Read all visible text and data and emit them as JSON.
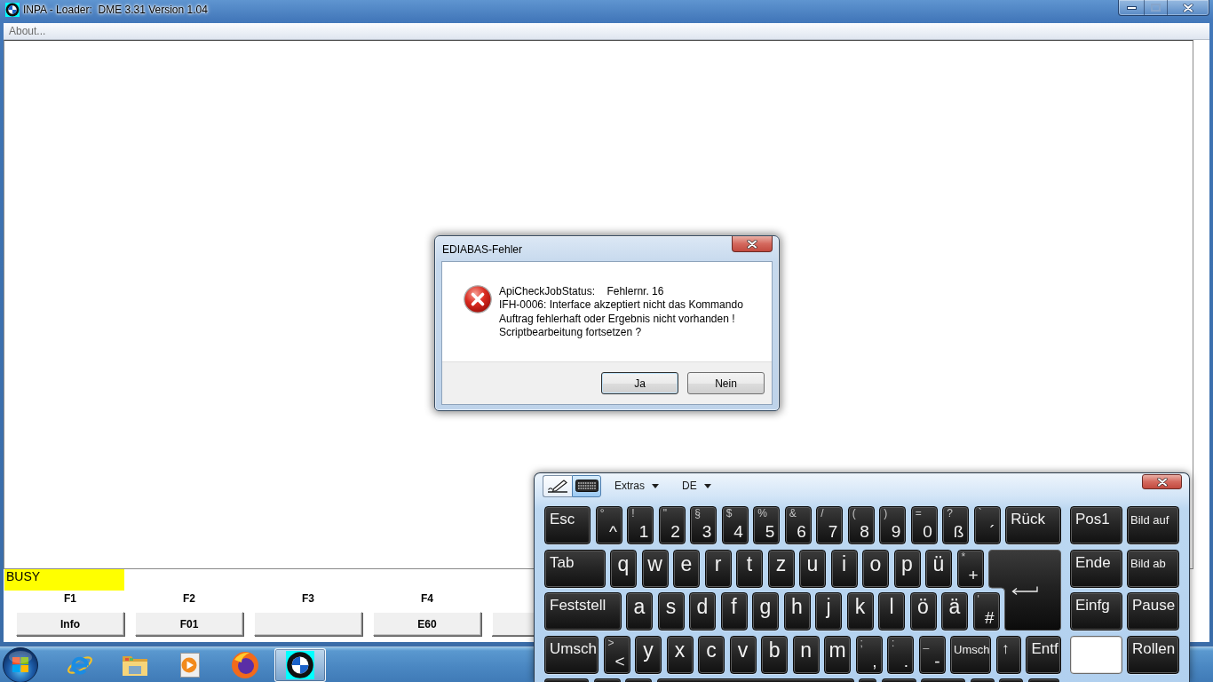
{
  "window": {
    "title": "INPA - Loader:  DME 3.31 Version 1.04",
    "caption_buttons": [
      {
        "kind": "minimize",
        "disabled": false
      },
      {
        "kind": "maximize",
        "disabled": true
      },
      {
        "kind": "close",
        "disabled": false
      }
    ]
  },
  "menu": [
    {
      "label": "About...",
      "disabled": true
    }
  ],
  "status": "BUSY",
  "function_keys": [
    {
      "key": "F1",
      "label": "Info",
      "partial": false
    },
    {
      "key": "F2",
      "label": "F01",
      "partial": false
    },
    {
      "key": "F3",
      "partial": false
    },
    {
      "key": "F4",
      "label": "E60",
      "partial": false
    },
    {
      "partial": true
    }
  ],
  "dialog": {
    "title": "EDIABAS-Fehler",
    "message": "ApiCheckJobStatus:    Fehlernr. 16\nIFH-0006: Interface akzeptiert nicht das Kommando\nAuftrag fehlerhaft oder Ergebnis nicht vorhanden !\nScriptbearbeitung fortsetzen ?",
    "buttons": [
      {
        "label": "Ja",
        "default": true
      },
      {
        "label": "Nein",
        "default": false
      }
    ]
  },
  "input_panel": {
    "modes": [
      {
        "kind": "pen",
        "selected": false
      },
      {
        "kind": "keyboard",
        "selected": true
      }
    ],
    "menus": [
      {
        "label": "Extras"
      },
      {
        "label": "DE"
      }
    ],
    "rows": [
      {
        "keys": [
          {
            "kind": "named",
            "label": "Esc"
          },
          {
            "kind": "symbol",
            "shift": "°",
            "label": "^"
          },
          {
            "kind": "symbol",
            "shift": "!",
            "label": "1"
          },
          {
            "kind": "symbol",
            "shift": "\"",
            "label": "2"
          },
          {
            "kind": "symbol",
            "shift": "§",
            "label": "3"
          },
          {
            "kind": "symbol",
            "shift": "$",
            "label": "4"
          },
          {
            "kind": "symbol",
            "shift": "%",
            "label": "5"
          },
          {
            "kind": "symbol",
            "shift": "&",
            "label": "6"
          },
          {
            "kind": "symbol",
            "shift": "/",
            "label": "7"
          },
          {
            "kind": "symbol",
            "shift": "(",
            "label": "8"
          },
          {
            "kind": "symbol",
            "shift": ")",
            "label": "9"
          },
          {
            "kind": "symbol",
            "shift": "=",
            "label": "0"
          },
          {
            "kind": "symbol",
            "shift": "?",
            "label": "ß"
          },
          {
            "kind": "symbol",
            "shift": "`",
            "label": "´"
          },
          {
            "kind": "named",
            "label": "Rück"
          }
        ],
        "nav_keys": [
          {
            "kind": "named",
            "label": "Pos1"
          },
          {
            "kind": "named-small",
            "label": "Bild auf"
          }
        ]
      },
      {
        "keys": [
          {
            "kind": "named",
            "label": "Tab"
          },
          {
            "kind": "letter",
            "label": "q"
          },
          {
            "kind": "letter",
            "label": "w"
          },
          {
            "kind": "letter",
            "label": "e"
          },
          {
            "kind": "letter",
            "label": "r"
          },
          {
            "kind": "letter",
            "label": "t"
          },
          {
            "kind": "letter",
            "label": "z"
          },
          {
            "kind": "letter",
            "label": "u"
          },
          {
            "kind": "letter",
            "label": "i"
          },
          {
            "kind": "letter",
            "label": "o"
          },
          {
            "kind": "letter",
            "label": "p"
          },
          {
            "kind": "letter",
            "label": "ü"
          },
          {
            "kind": "symbol",
            "shift": "*",
            "label": "+"
          },
          {
            "kind": "enter"
          }
        ],
        "nav_keys": [
          {
            "kind": "named",
            "label": "Ende"
          },
          {
            "kind": "named-small",
            "label": "Bild ab"
          }
        ]
      },
      {
        "keys": [
          {
            "kind": "named",
            "label": "Feststell"
          },
          {
            "kind": "letter",
            "label": "a"
          },
          {
            "kind": "letter",
            "label": "s"
          },
          {
            "kind": "letter",
            "label": "d"
          },
          {
            "kind": "letter",
            "label": "f"
          },
          {
            "kind": "letter",
            "label": "g"
          },
          {
            "kind": "letter",
            "label": "h"
          },
          {
            "kind": "letter",
            "label": "j"
          },
          {
            "kind": "letter",
            "label": "k"
          },
          {
            "kind": "letter",
            "label": "l"
          },
          {
            "kind": "letter",
            "label": "ö"
          },
          {
            "kind": "letter",
            "label": "ä"
          },
          {
            "kind": "symbol",
            "shift": "'",
            "label": "#"
          }
        ],
        "nav_keys": [
          {
            "kind": "named",
            "label": "Einfg"
          },
          {
            "kind": "named",
            "label": "Pause"
          }
        ]
      },
      {
        "keys": [
          {
            "kind": "named",
            "label": "Umsch"
          },
          {
            "kind": "symbol",
            "shift": ">",
            "label": "<"
          },
          {
            "kind": "letter",
            "label": "y"
          },
          {
            "kind": "letter",
            "label": "x"
          },
          {
            "kind": "letter",
            "label": "c"
          },
          {
            "kind": "letter",
            "label": "v"
          },
          {
            "kind": "letter",
            "label": "b"
          },
          {
            "kind": "letter",
            "label": "n"
          },
          {
            "kind": "letter",
            "label": "m"
          },
          {
            "kind": "symbol",
            "shift": ";",
            "label": ","
          },
          {
            "kind": "symbol",
            "shift": ":",
            "label": "."
          },
          {
            "kind": "symbol",
            "shift": "_",
            "label": "-"
          },
          {
            "kind": "named-small",
            "label": "Umsch"
          },
          {
            "kind": "named",
            "label": "↑"
          },
          {
            "kind": "named",
            "label": "Entf"
          }
        ],
        "nav_keys": [
          {
            "kind": "blank"
          },
          {
            "kind": "named",
            "label": "Rollen"
          }
        ]
      }
    ]
  },
  "taskbar": {
    "items": [
      {
        "kind": "browser",
        "selected": false
      },
      {
        "kind": "folder",
        "selected": false
      },
      {
        "kind": "media",
        "selected": false
      },
      {
        "kind": "globe",
        "selected": false
      },
      {
        "kind": "roundel",
        "selected": true
      }
    ]
  }
}
